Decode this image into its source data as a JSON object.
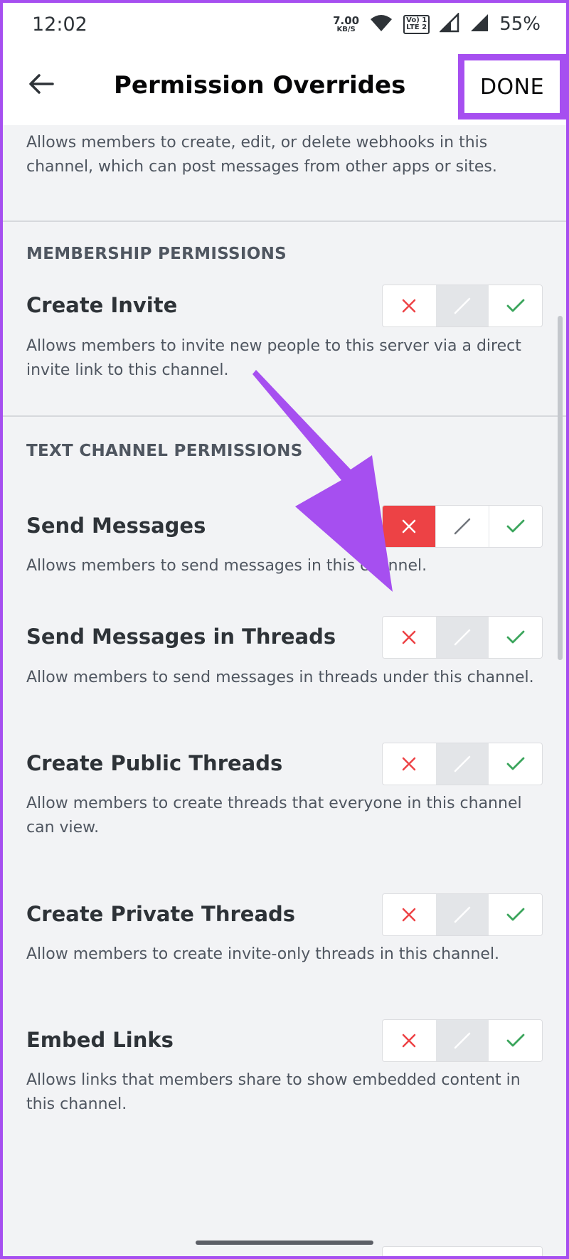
{
  "status_bar": {
    "time": "12:02",
    "net_speed_value": "7.00",
    "net_speed_unit": "KB/S",
    "network_badge_top": "Vo) 1",
    "network_badge_bottom": "LTE 2",
    "battery": "55%"
  },
  "header": {
    "title": "Permission Overrides",
    "done_label": "DONE"
  },
  "sections": {
    "webhooks_desc": "Allows members to create, edit, or delete webhooks in this channel, which can post messages from other apps or sites.",
    "membership_title": "MEMBERSHIP PERMISSIONS",
    "text_channel_title": "TEXT CHANNEL PERMISSIONS"
  },
  "permissions": [
    {
      "label": "Create Invite",
      "desc": "Allows members to invite new people to this server via a direct invite link to this channel.",
      "state": "neutral"
    },
    {
      "label": "Send Messages",
      "desc": "Allows members to send messages in this channel.",
      "state": "deny"
    },
    {
      "label": "Send Messages in Threads",
      "desc": "Allow members to send messages in threads under this channel.",
      "state": "neutral"
    },
    {
      "label": "Create Public Threads",
      "desc": "Allow members to create threads that everyone in this channel can view.",
      "state": "neutral"
    },
    {
      "label": "Create Private Threads",
      "desc": "Allow members to create invite-only threads in this channel.",
      "state": "neutral"
    },
    {
      "label": "Embed Links",
      "desc": "Allows links that members share to show embedded content in this channel.",
      "state": "neutral"
    }
  ],
  "colors": {
    "accent_annotation": "#a64ff0",
    "deny": "#ed4245",
    "allow": "#3ba55c"
  }
}
